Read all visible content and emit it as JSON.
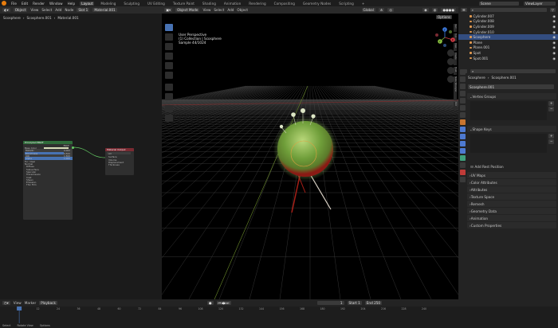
{
  "topbar": {
    "menus": [
      "File",
      "Edit",
      "Render",
      "Window",
      "Help"
    ],
    "workspaces": [
      "Layout",
      "Modeling",
      "Sculpting",
      "UV Editing",
      "Texture Paint",
      "Shading",
      "Animation",
      "Rendering",
      "Compositing",
      "Geometry Nodes",
      "Scripting"
    ],
    "active_workspace": "Layout",
    "scene": "Scene",
    "view_layer": "ViewLayer"
  },
  "node_editor": {
    "breadcrumb": [
      "Scosphere",
      "Scosphere.001",
      "Material.001"
    ],
    "header": {
      "editor": "Object",
      "menus": [
        "View",
        "Select",
        "Add",
        "Node"
      ],
      "slot": "Slot 1",
      "material": "Material.001"
    },
    "bsdf": {
      "title": "Principled BSDF",
      "output": "BSDF",
      "rows": [
        "Base Color",
        "Metallic",
        "Roughness",
        "IOR",
        "Alpha",
        "Normal",
        "Diffuse",
        "Subsurface",
        "Specular",
        "Transmission",
        "Coat",
        "Sheen",
        "Emission",
        "Thin Film"
      ],
      "values": [
        "0.000",
        "0.500",
        "1.500",
        "1.000"
      ],
      "fur_label": "Fur: Ideal"
    },
    "output_node": {
      "title": "Material Output",
      "target": "All",
      "rows": [
        "Surface",
        "Volume",
        "Displacement",
        "Thickness"
      ]
    }
  },
  "viewport": {
    "header": {
      "mode": "Object Mode",
      "menus": [
        "View",
        "Select",
        "Add",
        "Object"
      ],
      "orientation": "Global",
      "options": "Options"
    },
    "overlay_lines": [
      "User Perspective",
      "(1) Collection | Scosphere",
      "Sample 44/1024"
    ],
    "side_tabs": [
      "Item",
      "Tool",
      "View",
      "Create",
      "Fluid",
      "Node Wrangler",
      "Edit"
    ],
    "gizmo": {
      "x": "X",
      "y": "Y",
      "z": "Z"
    }
  },
  "outliner": {
    "search_placeholder": "",
    "items": [
      {
        "name": "Cylinder.007",
        "selected": false
      },
      {
        "name": "Cylinder.008",
        "selected": false
      },
      {
        "name": "Cylinder.009",
        "selected": false
      },
      {
        "name": "Cylinder.010",
        "selected": false
      },
      {
        "name": "Scosphere",
        "selected": true
      },
      {
        "name": "Plane",
        "selected": false
      },
      {
        "name": "Plane.001",
        "selected": false
      },
      {
        "name": "Spot",
        "selected": false
      },
      {
        "name": "Spot.001",
        "selected": false
      }
    ]
  },
  "properties": {
    "breadcrumb": [
      "Scosphere",
      "Scosphere.001"
    ],
    "mesh_name": "Scosphere.001",
    "panels": [
      "Vertex Groups",
      "Shape Keys",
      "Add Rest Position",
      "UV Maps",
      "Color Attributes",
      "Attributes",
      "Texture Space",
      "Remesh",
      "Geometry Data",
      "Animation",
      "Custom Properties"
    ]
  },
  "timeline": {
    "menus": [
      "View",
      "Marker",
      "Playback"
    ],
    "current_frame": "1",
    "start_label": "Start",
    "start": "1",
    "end_label": "End",
    "end": "250",
    "ticks": [
      "0",
      "12",
      "24",
      "36",
      "48",
      "60",
      "72",
      "84",
      "96",
      "108",
      "120",
      "132",
      "144",
      "156",
      "168",
      "180",
      "192",
      "204",
      "216",
      "228",
      "240"
    ]
  },
  "status_bar": [
    "Select",
    "Rotate View",
    "Options"
  ]
}
